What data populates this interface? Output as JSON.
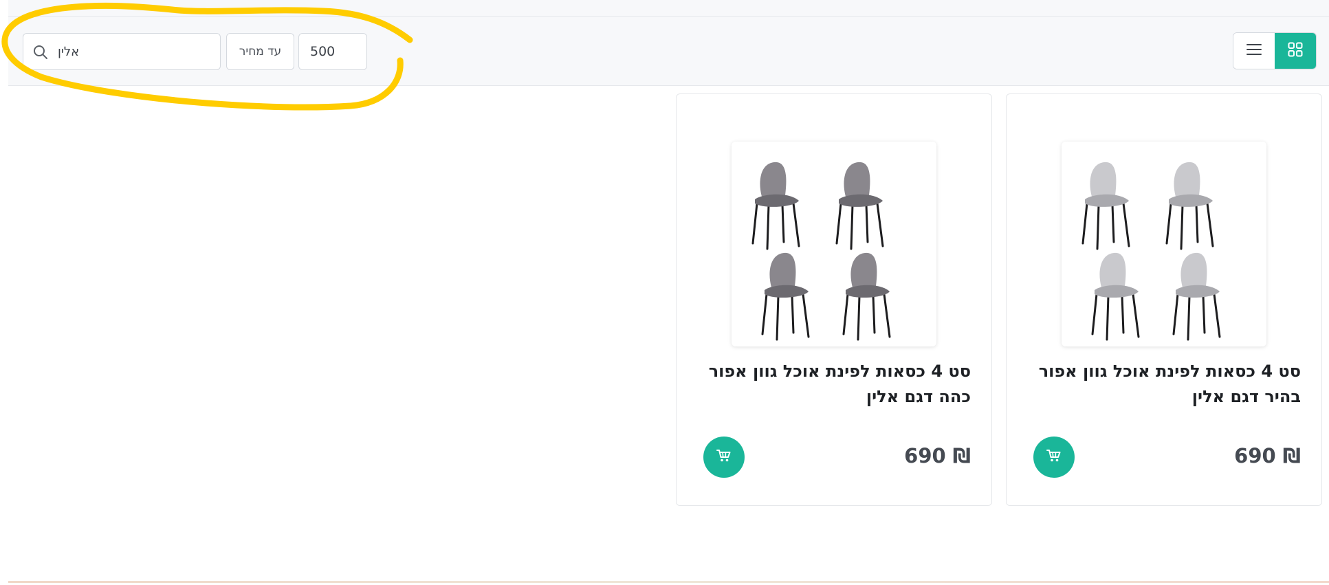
{
  "filters": {
    "search_value": "אלין",
    "price_label": "עד מחיר",
    "price_value": "500"
  },
  "view_toggle": {
    "active": "grid",
    "icons": [
      "list-icon",
      "grid-icon"
    ]
  },
  "products": [
    {
      "title": "סט 4 כסאות לפינת אוכל גוון אפור בהיר דגם אלין",
      "price": "690 ₪",
      "chair_color": "#c9c9cd",
      "chair_shade": "#a9a9ae"
    },
    {
      "title": "סט 4 כסאות לפינת אוכל גוון אפור כהה דגם אלין",
      "price": "690 ₪",
      "chair_color": "#8a878d",
      "chair_shade": "#6c6a70"
    }
  ],
  "colors": {
    "accent": "#1ab699",
    "annotation": "#ffcc00",
    "toolbar_bg": "#f7f8fa"
  }
}
